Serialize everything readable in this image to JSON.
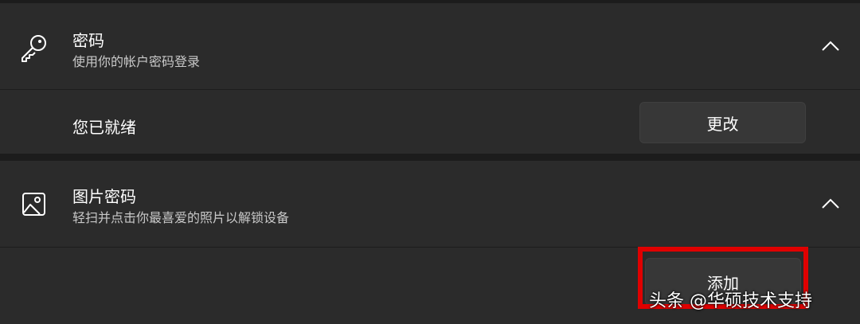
{
  "password": {
    "title": "密码",
    "subtitle": "使用你的帐户密码登录",
    "status": "您已就绪",
    "button": "更改",
    "icon": "key-icon",
    "expand_icon": "chevron-up-icon"
  },
  "picture_password": {
    "title": "图片密码",
    "subtitle": "轻扫并点击你最喜爱的照片以解锁设备",
    "button": "添加",
    "icon": "image-icon",
    "expand_icon": "chevron-up-icon"
  },
  "watermark": "头条 @华硕技术支持",
  "colors": {
    "highlight": "#e00000",
    "panel": "#2b2b2b",
    "background": "#1c1c1c"
  }
}
